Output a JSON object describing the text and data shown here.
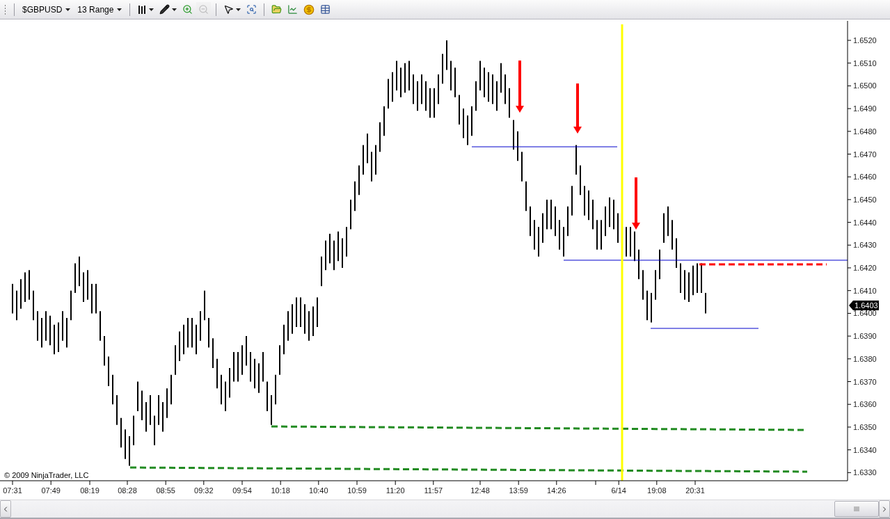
{
  "toolbar": {
    "instrument": {
      "label": "$GBPUSD",
      "menu": true
    },
    "period": {
      "label": "13 Range",
      "menu": true
    },
    "tool_groups": [
      [
        {
          "disabled": false,
          "menu": true
        },
        {
          "disabled": false,
          "menu": true
        },
        {
          "disabled": false,
          "menu": false
        },
        {
          "disabled": true,
          "menu": false
        }
      ],
      [
        {
          "disabled": false,
          "menu": true
        },
        {
          "disabled": false,
          "menu": false
        }
      ],
      [
        {
          "disabled": false,
          "menu": false
        },
        {
          "disabled": false,
          "menu": false
        },
        {
          "disabled": false,
          "menu": false
        },
        {
          "disabled": false,
          "menu": false
        }
      ]
    ]
  },
  "chart": {
    "copyright": "© 2009 NinjaTrader, LLC",
    "price_labels": [
      "1.6520",
      "1.6510",
      "1.6500",
      "1.6490",
      "1.6480",
      "1.6470",
      "1.6460",
      "1.6450",
      "1.6440",
      "1.6430",
      "1.6420",
      "1.6410",
      "1.6400",
      "1.6390",
      "1.6380",
      "1.6370",
      "1.6360",
      "1.6350",
      "1.6340",
      "1.6330"
    ],
    "last_price": "1.6403",
    "time_labels": [
      "07:31",
      "07:49",
      "08:19",
      "08:28",
      "08:55",
      "09:32",
      "09:54",
      "10:18",
      "10:40",
      "10:59",
      "11:20",
      "11:57",
      "12:48",
      "13:59",
      "14:26",
      "6/14",
      "19:08",
      "20:31"
    ]
  }
}
